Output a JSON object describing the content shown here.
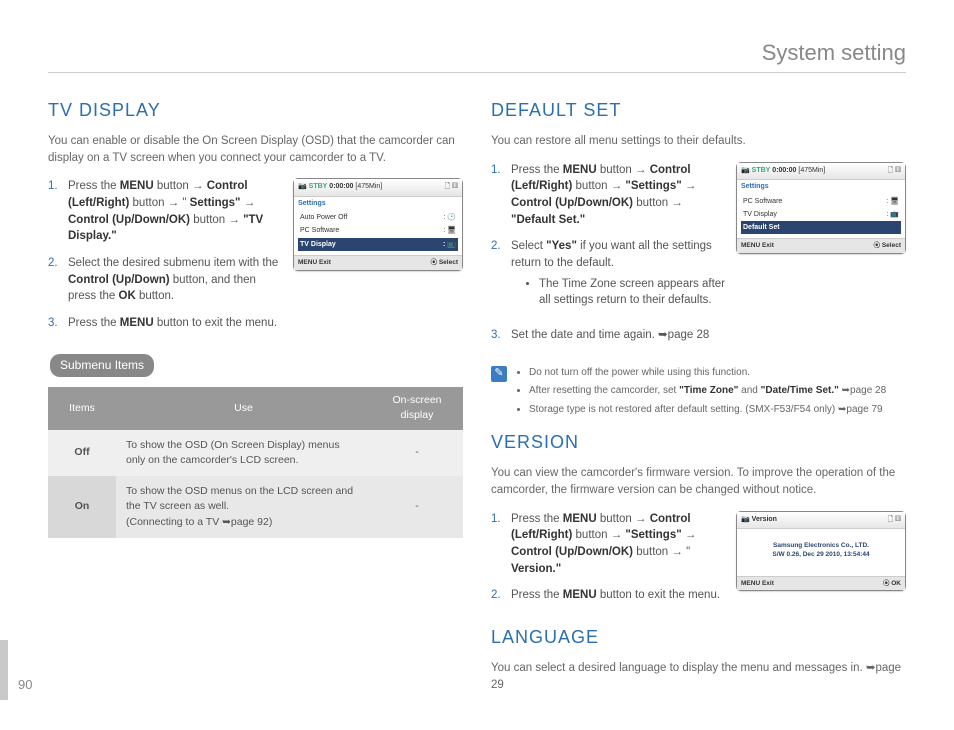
{
  "header": {
    "title": "System setting"
  },
  "pageNumber": "90",
  "left": {
    "tvDisplay": {
      "heading": "TV DISPLAY",
      "intro": "You can enable or disable the On Screen Display (OSD) that the camcorder can display on a TV screen when you connect your camcorder to a TV.",
      "step1_a": "Press the ",
      "step1_menu": "MENU",
      "step1_b": " button → ",
      "step1_ctrl1": "Control (Left/Right)",
      "step1_c": " button → \" ",
      "step1_settings": "Settings\"",
      "step1_d": " → ",
      "step1_ctrl2": "Control (Up/Down/OK)",
      "step1_e": " button → ",
      "step1_target": "\"TV Display.\"",
      "step2_a": "Select the desired submenu item with the ",
      "step2_ctrl": "Control (Up/Down)",
      "step2_b": " button, and then press the ",
      "step2_ok": "OK",
      "step2_c": " button.",
      "step3_a": "Press the ",
      "step3_menu": "MENU",
      "step3_b": " button to exit the menu.",
      "submenuLabel": "Submenu Items",
      "table": {
        "h_items": "Items",
        "h_use": "Use",
        "h_osd": "On-screen display",
        "off_label": "Off",
        "off_use": "To show the OSD (On Screen Display) menus only on the camcorder's LCD screen.",
        "off_osd": "-",
        "on_label": "On",
        "on_use_1": "To show the OSD menus on the LCD screen and the TV screen as well.",
        "on_use_2": "(Connecting to a TV ➥page 92)",
        "on_osd": "-"
      },
      "screen": {
        "stby": "STBY",
        "time": "0:00:00",
        "min": "[475Min]",
        "settings": "Settings",
        "rows": [
          "Auto Power Off",
          "PC Software",
          "TV Display"
        ],
        "exit": "MENU Exit",
        "select": "⦿ Select"
      }
    }
  },
  "right": {
    "defaultSet": {
      "heading": "DEFAULT SET",
      "intro": "You can restore all menu settings to their defaults.",
      "s1_a": "Press the ",
      "s1_menu": "MENU",
      "s1_b": " button → ",
      "s1_ctrl1": "Control (Left/Right)",
      "s1_c": " button → ",
      "s1_settings": "\"Settings\"",
      "s1_d": " → ",
      "s1_ctrl2": "Control (Up/Down/OK)",
      "s1_e": " button → ",
      "s1_target": "\"Default Set.\"",
      "s2_a": "Select ",
      "s2_yes": "\"Yes\"",
      "s2_b": " if you want all the settings return to the default.",
      "s2_bullet": "The Time Zone screen appears after all settings return to their defaults.",
      "s3": "Set the date and time again. ➥page 28",
      "notes": {
        "n1": "Do not turn off the power while using this function.",
        "n2_a": "After resetting the camcorder, set ",
        "n2_tz": "\"Time Zone\"",
        "n2_b": " and ",
        "n2_dt": "\"Date/Time Set.\"",
        "n2_c": " ➥page 28",
        "n3": "Storage type is not restored after default setting. (SMX-F53/F54 only) ➥page 79"
      },
      "screen": {
        "stby": "STBY",
        "time": "0:00:00",
        "min": "[475Min]",
        "settings": "Settings",
        "rows": [
          "PC Software",
          "TV Display",
          "Default Set"
        ],
        "exit": "MENU Exit",
        "select": "⦿ Select"
      }
    },
    "version": {
      "heading": "VERSION",
      "intro": "You can view the camcorder's firmware version. To improve the operation of the camcorder, the firmware version can be changed without notice.",
      "s1_a": "Press the ",
      "s1_menu": "MENU",
      "s1_b": " button → ",
      "s1_ctrl1": "Control (Left/Right)",
      "s1_c": " button → ",
      "s1_settings": "\"Settings\"",
      "s1_d": " → ",
      "s1_ctrl2": "Control (Up/Down/OK)",
      "s1_e": " button → \" ",
      "s1_target": "Version.\"",
      "s2_a": "Press the ",
      "s2_menu": "MENU",
      "s2_b": " button to exit the menu.",
      "screen": {
        "title": "Version",
        "line1": "Samsung Electronics Co., LTD.",
        "line2": "S/W 0.26, Dec 29 2010, 13:54:44",
        "exit": "MENU Exit",
        "ok": "⦿ OK"
      }
    },
    "language": {
      "heading": "LANGUAGE",
      "intro": "You can select a desired language to display the menu and messages in. ➥page 29"
    }
  }
}
